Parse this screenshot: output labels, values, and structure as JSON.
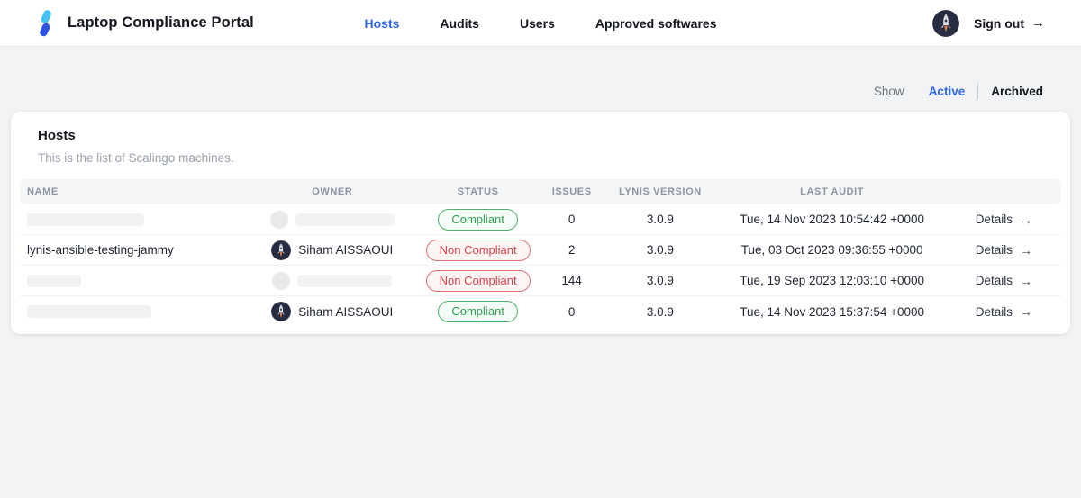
{
  "brand": {
    "title": "Laptop Compliance Portal"
  },
  "nav": {
    "items": [
      {
        "label": "Hosts",
        "active": true
      },
      {
        "label": "Audits",
        "active": false
      },
      {
        "label": "Users",
        "active": false
      },
      {
        "label": "Approved softwares",
        "active": false
      }
    ]
  },
  "account": {
    "signout_label": "Sign out",
    "arrow": "→",
    "avatar": "rocket-avatar"
  },
  "filter": {
    "show_label": "Show",
    "options": [
      {
        "label": "Active",
        "selected": true
      },
      {
        "label": "Archived",
        "selected": false
      }
    ]
  },
  "card": {
    "title": "Hosts",
    "subtitle": "This is the list of Scalingo machines."
  },
  "table": {
    "headers": [
      "Name",
      "Owner",
      "Status",
      "Issues",
      "Lynis version",
      "Last audit"
    ],
    "details_label": "Details",
    "details_arrow": "→",
    "rows": [
      {
        "name": "",
        "name_redacted": true,
        "name_redact_width": 130,
        "owner": "",
        "owner_redacted": true,
        "owner_redact_width": 110,
        "status": "Compliant",
        "status_type": "compliant",
        "issues": "0",
        "lynis_version": "3.0.9",
        "last_audit": "Tue, 14 Nov 2023 10:54:42 +0000"
      },
      {
        "name": "lynis-ansible-testing-jammy",
        "name_redacted": false,
        "owner": "Siham AISSAOUI",
        "owner_redacted": false,
        "status": "Non Compliant",
        "status_type": "non-compliant",
        "issues": "2",
        "lynis_version": "3.0.9",
        "last_audit": "Tue, 03 Oct 2023 09:36:55 +0000"
      },
      {
        "name": "",
        "name_redacted": true,
        "name_redact_width": 60,
        "owner": "",
        "owner_redacted": true,
        "owner_redact_width": 105,
        "status": "Non Compliant",
        "status_type": "non-compliant",
        "issues": "144",
        "lynis_version": "3.0.9",
        "last_audit": "Tue, 19 Sep 2023 12:03:10 +0000"
      },
      {
        "name": "",
        "name_redacted": true,
        "name_redact_width": 138,
        "owner": "Siham AISSAOUI",
        "owner_redacted": false,
        "status": "Compliant",
        "status_type": "compliant",
        "issues": "0",
        "lynis_version": "3.0.9",
        "last_audit": "Tue, 14 Nov 2023 15:37:54 +0000"
      }
    ]
  },
  "colors": {
    "accent_blue": "#2d68e8",
    "compliant_green": "#2f9e4f",
    "non_compliant_red": "#d9444c",
    "logo_cyan": "#41c3ee",
    "logo_blue": "#2c53e5"
  }
}
